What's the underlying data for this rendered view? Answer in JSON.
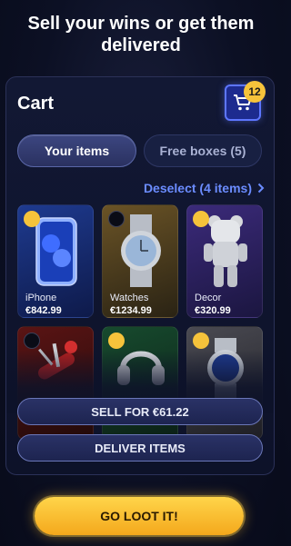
{
  "headline": "Sell your wins or get them delivered",
  "cart": {
    "title": "Cart",
    "count": "12",
    "tabs": {
      "your_items": "Your items",
      "free_boxes": "Free boxes (5)"
    },
    "deselect": "Deselect (4 items)",
    "items": [
      {
        "name": "iPhone",
        "price": "€842.99",
        "selected": true,
        "icon": "iphone-icon"
      },
      {
        "name": "Watches",
        "price": "€1234.99",
        "selected": false,
        "icon": "watch-icon"
      },
      {
        "name": "Decor",
        "price": "€320.99",
        "selected": true,
        "icon": "bear-figure-icon"
      },
      {
        "name": "",
        "price": "",
        "selected": false,
        "icon": "pocket-knife-icon"
      },
      {
        "name": "",
        "price": "",
        "selected": true,
        "icon": "headphones-icon"
      },
      {
        "name": "",
        "price": "",
        "selected": true,
        "icon": "wristwatch-icon"
      }
    ],
    "sell_label": "SELL FOR €61.22",
    "deliver_label": "DELIVER ITEMS"
  },
  "cta": {
    "label": "GO LOOT IT!"
  },
  "colors": {
    "accent": "#f6c33b",
    "link": "#6b8cff",
    "cart_button": "#1d2b8f"
  }
}
